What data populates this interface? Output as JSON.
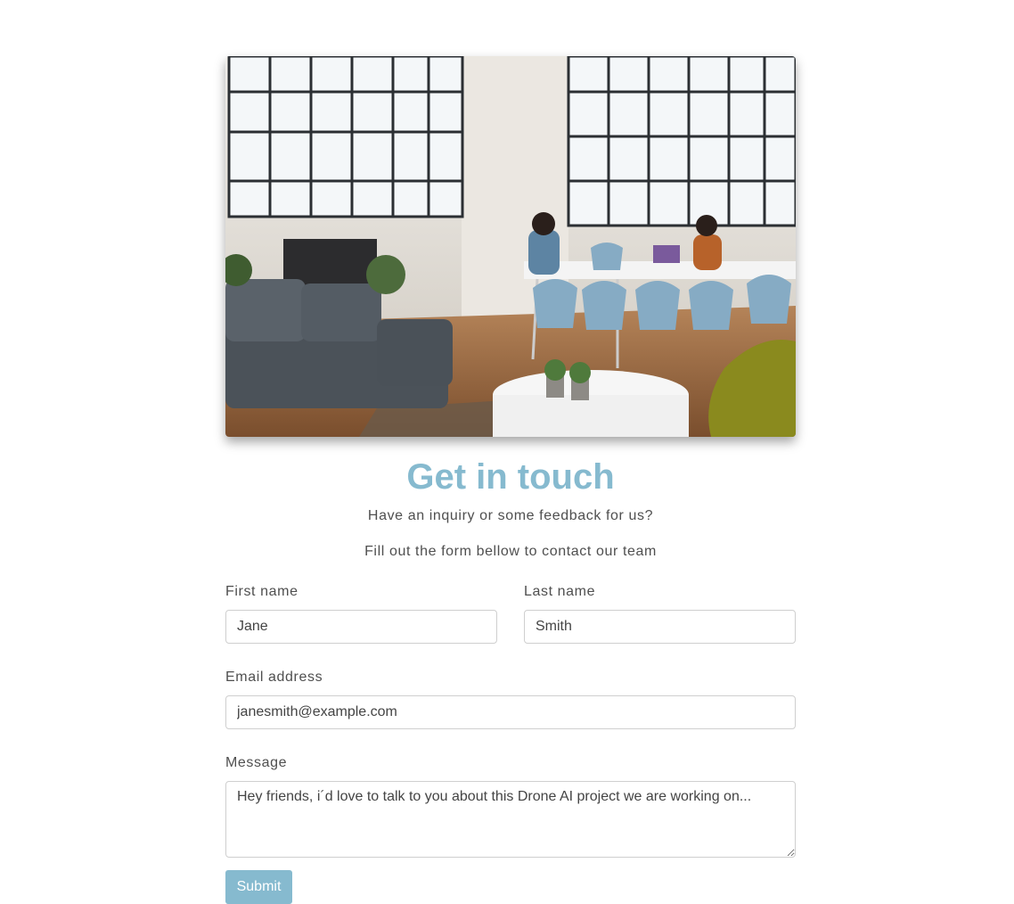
{
  "hero": {
    "image_description_icon": "office-photo-image"
  },
  "header": {
    "title": "Get in touch",
    "subtitle1": "Have an inquiry or some feedback for us?",
    "subtitle2": "Fill out the form bellow to contact our team"
  },
  "form": {
    "first_name": {
      "label": "First name",
      "value": "Jane"
    },
    "last_name": {
      "label": "Last name",
      "value": "Smith"
    },
    "email": {
      "label": "Email address",
      "value": "janesmith@example.com"
    },
    "message": {
      "label": "Message",
      "value": "Hey friends, i´d love to talk to you about this Drone AI project we are working on..."
    },
    "submit_label": "Submit"
  },
  "colors": {
    "accent": "#86bacf",
    "text": "#4f4f4f",
    "border": "#cfcfcf"
  }
}
